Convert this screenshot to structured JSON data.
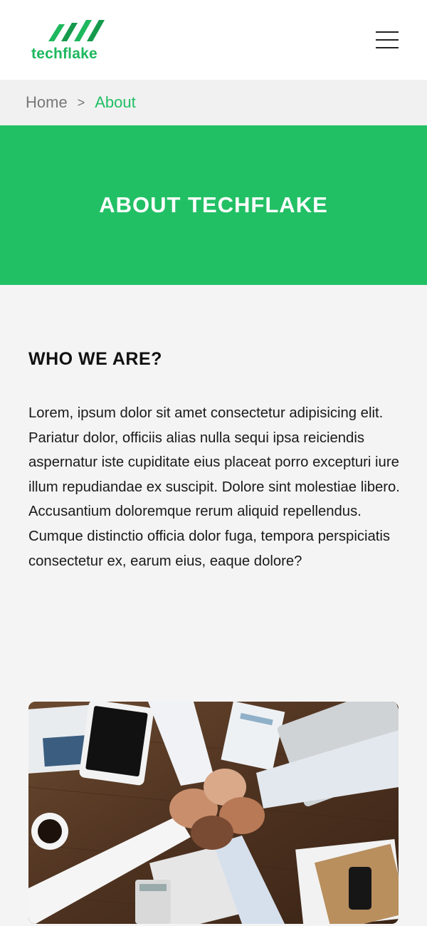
{
  "brand": {
    "name": "techflake",
    "color": "#1eb85e"
  },
  "header": {
    "menu_icon": "hamburger-menu-icon"
  },
  "breadcrumb": {
    "home": "Home",
    "separator": ">",
    "current": "About"
  },
  "banner": {
    "title": "ABOUT TECHFLAKE",
    "color": "#22c065"
  },
  "about": {
    "heading": "WHO WE ARE?",
    "body": "Lorem, ipsum dolor sit amet consectetur adipisicing elit. Pariatur dolor, officiis alias nulla sequi ipsa reiciendis aspernatur iste cupiditate eius placeat porro excepturi iure illum repudiandae ex suscipit. Dolore sint molestiae libero. Accusantium doloremque rerum aliquid repellendus. Cumque distinctio officia dolor fuga, tempora perspiciatis consectetur ex, earum eius, eaque dolore?"
  },
  "image": {
    "depicts": "team-fist-bump-photo"
  }
}
